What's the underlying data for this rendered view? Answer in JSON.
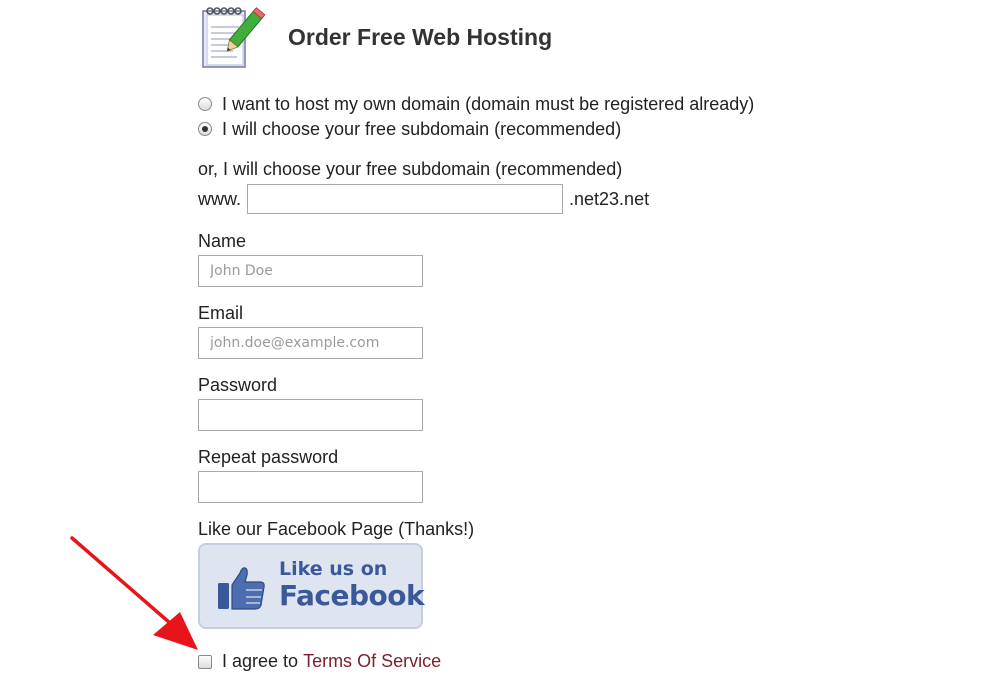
{
  "header": {
    "title": "Order Free Web Hosting",
    "icon": "notepad-pencil-icon"
  },
  "hosting_options": [
    {
      "label": "I want to host my own domain (domain must be registered already)",
      "selected": false
    },
    {
      "label": "I will choose your free subdomain (recommended)",
      "selected": true
    }
  ],
  "subdomain": {
    "intro": "or, I will choose your free subdomain (recommended)",
    "prefix": "www.",
    "value": "",
    "suffix": ".net23.net"
  },
  "form": {
    "name_label": "Name",
    "name_placeholder": "John Doe",
    "email_label": "Email",
    "email_placeholder": "john.doe@example.com",
    "password_label": "Password",
    "repeat_password_label": "Repeat password"
  },
  "facebook": {
    "prompt": "Like our Facebook Page (Thanks!)",
    "line1": "Like us on",
    "line2": "Facebook",
    "color": "#3b5998",
    "icon": "thumbs-up-icon"
  },
  "terms": {
    "prefix": "I agree to",
    "link": "Terms Of Service",
    "checked": false,
    "link_color": "#7a1f2b"
  },
  "annotation": {
    "arrow_color": "#e8141b",
    "icon": "red-arrow-icon"
  }
}
